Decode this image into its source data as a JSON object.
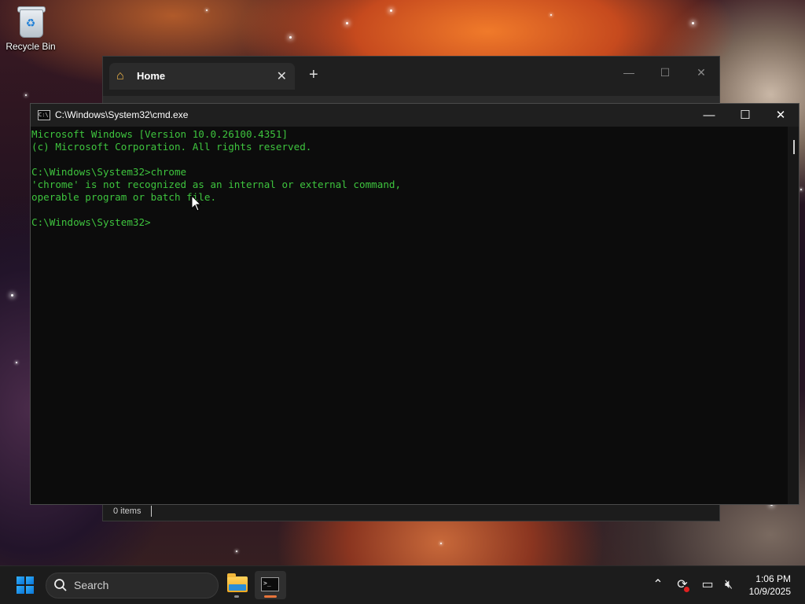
{
  "desktop": {
    "recycle_bin_label": "Recycle Bin"
  },
  "explorer": {
    "tab_label": "Home",
    "tab_close": "✕",
    "new_tab": "+",
    "minimize": "—",
    "maximize": "☐",
    "close": "✕",
    "status_items": "0 items"
  },
  "cmd": {
    "title": "C:\\Windows\\System32\\cmd.exe",
    "icon_text": "C:\\",
    "minimize": "—",
    "maximize": "☐",
    "close": "✕",
    "lines": [
      "Microsoft Windows [Version 10.0.26100.4351]",
      "(c) Microsoft Corporation. All rights reserved.",
      "",
      "C:\\Windows\\System32>chrome",
      "'chrome' is not recognized as an internal or external command,",
      "operable program or batch file.",
      "",
      "C:\\Windows\\System32>"
    ],
    "text_color": "#3ec43e"
  },
  "taskbar": {
    "search_placeholder": "Search",
    "time": "1:06 PM",
    "date": "10/9/2025",
    "icons": [
      "start-windows-icon",
      "search-icon",
      "file-explorer-icon",
      "command-prompt-icon",
      "show-hidden-icons-chevron",
      "sync-icon",
      "network-icon",
      "volume-muted-icon"
    ]
  },
  "colors": {
    "accent_blue": "#0a74d6",
    "taskbar_bg": "#1c1c1c",
    "indicator_orange": "#e8743b",
    "indicator_gray": "#8a8a8a"
  }
}
